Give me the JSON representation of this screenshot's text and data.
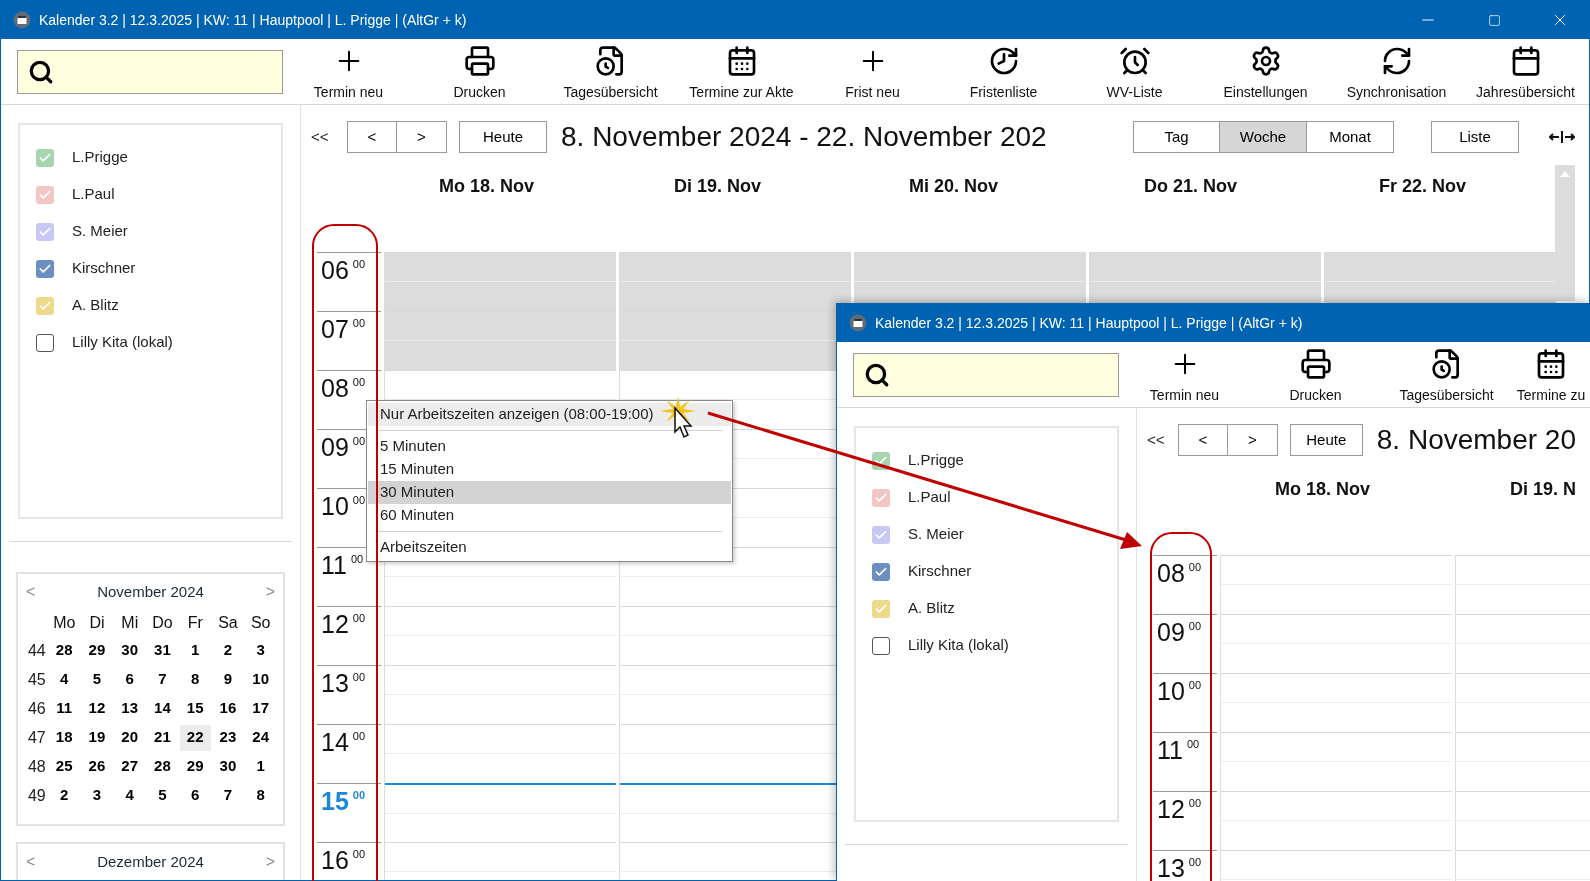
{
  "windows": [
    {
      "title": "Kalender 3.2 | 12.3.2025 | KW: 11 | Hauptpool | L. Prigge | (AltGr + k)",
      "window_controls": [
        {
          "kind": "minimize"
        },
        {
          "kind": "maximize"
        },
        {
          "kind": "close"
        }
      ],
      "toolbar": [
        {
          "kind": "new-appointment",
          "label": "Termin neu"
        },
        {
          "kind": "print",
          "label": "Drucken"
        },
        {
          "kind": "day-overview",
          "label": "Tagesübersicht"
        },
        {
          "kind": "file-appointments",
          "label": "Termine zur Akte"
        },
        {
          "kind": "new-deadline",
          "label": "Frist neu"
        },
        {
          "kind": "deadline-list",
          "label": "Fristenliste"
        },
        {
          "kind": "follow-up",
          "label": "WV-Liste"
        },
        {
          "kind": "settings",
          "label": "Einstellungen"
        },
        {
          "kind": "sync",
          "label": "Synchronisation"
        },
        {
          "kind": "year-overview",
          "label": "Jahresübersicht"
        }
      ],
      "calendars": [
        {
          "name": "L.Prigge",
          "checked": true,
          "color": "#a8d5b0"
        },
        {
          "name": "L.Paul",
          "checked": true,
          "color": "#f3c6c6"
        },
        {
          "name": "S. Meier",
          "checked": true,
          "color": "#c8c8f5"
        },
        {
          "name": "Kirschner",
          "checked": true,
          "color": "#6b8fc0"
        },
        {
          "name": "A. Blitz",
          "checked": true,
          "color": "#ecd98a"
        },
        {
          "name": "Lilly Kita (lokal)",
          "checked": false
        }
      ],
      "mini_calendars": [
        {
          "title": "November 2024",
          "prev": "<",
          "next": ">",
          "weekdays": [
            "Mo",
            "Di",
            "Mi",
            "Do",
            "Fr",
            "Sa",
            "So"
          ],
          "weeks": [
            {
              "week": "44",
              "days": [
                {
                  "d": "28",
                  "selected": false
                },
                {
                  "d": "29",
                  "selected": false
                },
                {
                  "d": "30",
                  "selected": false
                },
                {
                  "d": "31",
                  "selected": false
                },
                {
                  "d": "1",
                  "selected": false
                },
                {
                  "d": "2",
                  "selected": false
                },
                {
                  "d": "3",
                  "selected": false
                }
              ]
            },
            {
              "week": "45",
              "days": [
                {
                  "d": "4",
                  "selected": false
                },
                {
                  "d": "5",
                  "selected": false
                },
                {
                  "d": "6",
                  "selected": false
                },
                {
                  "d": "7",
                  "selected": false
                },
                {
                  "d": "8",
                  "selected": false
                },
                {
                  "d": "9",
                  "selected": false
                },
                {
                  "d": "10",
                  "selected": false
                }
              ]
            },
            {
              "week": "46",
              "days": [
                {
                  "d": "11",
                  "selected": false
                },
                {
                  "d": "12",
                  "selected": false
                },
                {
                  "d": "13",
                  "selected": false
                },
                {
                  "d": "14",
                  "selected": false
                },
                {
                  "d": "15",
                  "selected": false
                },
                {
                  "d": "16",
                  "selected": false
                },
                {
                  "d": "17",
                  "selected": false
                }
              ]
            },
            {
              "week": "47",
              "days": [
                {
                  "d": "18",
                  "selected": false
                },
                {
                  "d": "19",
                  "selected": false
                },
                {
                  "d": "20",
                  "selected": false
                },
                {
                  "d": "21",
                  "selected": false
                },
                {
                  "d": "22",
                  "selected": true
                },
                {
                  "d": "23",
                  "selected": false
                },
                {
                  "d": "24",
                  "selected": false
                }
              ]
            },
            {
              "week": "48",
              "days": [
                {
                  "d": "25",
                  "selected": false
                },
                {
                  "d": "26",
                  "selected": false
                },
                {
                  "d": "27",
                  "selected": false
                },
                {
                  "d": "28",
                  "selected": false
                },
                {
                  "d": "29",
                  "selected": false
                },
                {
                  "d": "30",
                  "selected": false
                },
                {
                  "d": "1",
                  "selected": false
                }
              ]
            },
            {
              "week": "49",
              "days": [
                {
                  "d": "2",
                  "selected": false
                },
                {
                  "d": "3",
                  "selected": false
                },
                {
                  "d": "4",
                  "selected": false
                },
                {
                  "d": "5",
                  "selected": false
                },
                {
                  "d": "6",
                  "selected": false
                },
                {
                  "d": "7",
                  "selected": false
                },
                {
                  "d": "8",
                  "selected": false
                }
              ]
            }
          ]
        },
        {
          "title": "Dezember 2024",
          "prev": "<",
          "next": ">"
        }
      ],
      "nav": {
        "first": "<<",
        "prev": "<",
        "next": ">",
        "today": "Heute",
        "range": "8. November 2024 - 22. November 202"
      },
      "views": [
        {
          "label": "Tag",
          "selected": false
        },
        {
          "label": "Woche",
          "selected": true
        },
        {
          "label": "Monat",
          "selected": false
        }
      ],
      "list_button": "Liste",
      "days": [
        "Mo 18. Nov",
        "Di 19. Nov",
        "Mi 20. Nov",
        "Do 21. Nov",
        "Fr 22. Nov"
      ],
      "hours": [
        {
          "hour": "06",
          "minutes": "00",
          "off": true,
          "current": false
        },
        {
          "hour": "07",
          "minutes": "00",
          "off": true,
          "current": false
        },
        {
          "hour": "08",
          "minutes": "00",
          "off": false,
          "current": false
        },
        {
          "hour": "09",
          "minutes": "00",
          "off": false,
          "current": false
        },
        {
          "hour": "10",
          "minutes": "00",
          "off": false,
          "current": false
        },
        {
          "hour": "11",
          "minutes": "00",
          "off": false,
          "current": false
        },
        {
          "hour": "12",
          "minutes": "00",
          "off": false,
          "current": false
        },
        {
          "hour": "13",
          "minutes": "00",
          "off": false,
          "current": false
        },
        {
          "hour": "14",
          "minutes": "00",
          "off": false,
          "current": false
        },
        {
          "hour": "15",
          "minutes": "00",
          "off": false,
          "current": true
        },
        {
          "hour": "16",
          "minutes": "00",
          "off": false,
          "current": false
        }
      ]
    },
    {
      "title": "Kalender 3.2 | 12.3.2025 | KW: 11 | Hauptpool | L. Prigge | (AltGr + k)",
      "toolbar": [
        {
          "kind": "new-appointment",
          "label": "Termin neu"
        },
        {
          "kind": "print",
          "label": "Drucken"
        },
        {
          "kind": "day-overview",
          "label": "Tagesübersicht"
        },
        {
          "kind": "file-appointments",
          "label": "Termine zu"
        }
      ],
      "calendars": [
        {
          "name": "L.Prigge",
          "checked": true,
          "color": "#a8d5b0"
        },
        {
          "name": "L.Paul",
          "checked": true,
          "color": "#f3c6c6"
        },
        {
          "name": "S. Meier",
          "checked": true,
          "color": "#c8c8f5"
        },
        {
          "name": "Kirschner",
          "checked": true,
          "color": "#6b8fc0"
        },
        {
          "name": "A. Blitz",
          "checked": true,
          "color": "#ecd98a"
        },
        {
          "name": "Lilly Kita (lokal)",
          "checked": false
        }
      ],
      "nav": {
        "first": "<<",
        "prev": "<",
        "next": ">",
        "today": "Heute",
        "range": "8. November 20"
      },
      "days": [
        "Mo 18. Nov",
        "Di 19. N"
      ],
      "hours": [
        {
          "hour": "08",
          "minutes": "00",
          "off": false,
          "current": false
        },
        {
          "hour": "09",
          "minutes": "00",
          "off": false,
          "current": false
        },
        {
          "hour": "10",
          "minutes": "00",
          "off": false,
          "current": false
        },
        {
          "hour": "11",
          "minutes": "00",
          "off": false,
          "current": false
        },
        {
          "hour": "12",
          "minutes": "00",
          "off": false,
          "current": false
        },
        {
          "hour": "13",
          "minutes": "00",
          "off": false,
          "current": false
        }
      ]
    }
  ],
  "context_menu": {
    "items": [
      {
        "kind": "item",
        "label": "Nur Arbeitszeiten anzeigen (08:00-19:00)",
        "highlighted": true,
        "selected": false
      },
      {
        "kind": "separator"
      },
      {
        "kind": "item",
        "label": "5 Minuten",
        "highlighted": false,
        "selected": false
      },
      {
        "kind": "item",
        "label": "15 Minuten",
        "highlighted": false,
        "selected": false
      },
      {
        "kind": "item",
        "label": "30 Minuten",
        "highlighted": false,
        "selected": true
      },
      {
        "kind": "item",
        "label": "60 Minuten",
        "highlighted": false,
        "selected": false
      },
      {
        "kind": "separator"
      },
      {
        "kind": "item",
        "label": "Arbeitszeiten",
        "highlighted": false,
        "selected": false
      }
    ]
  }
}
